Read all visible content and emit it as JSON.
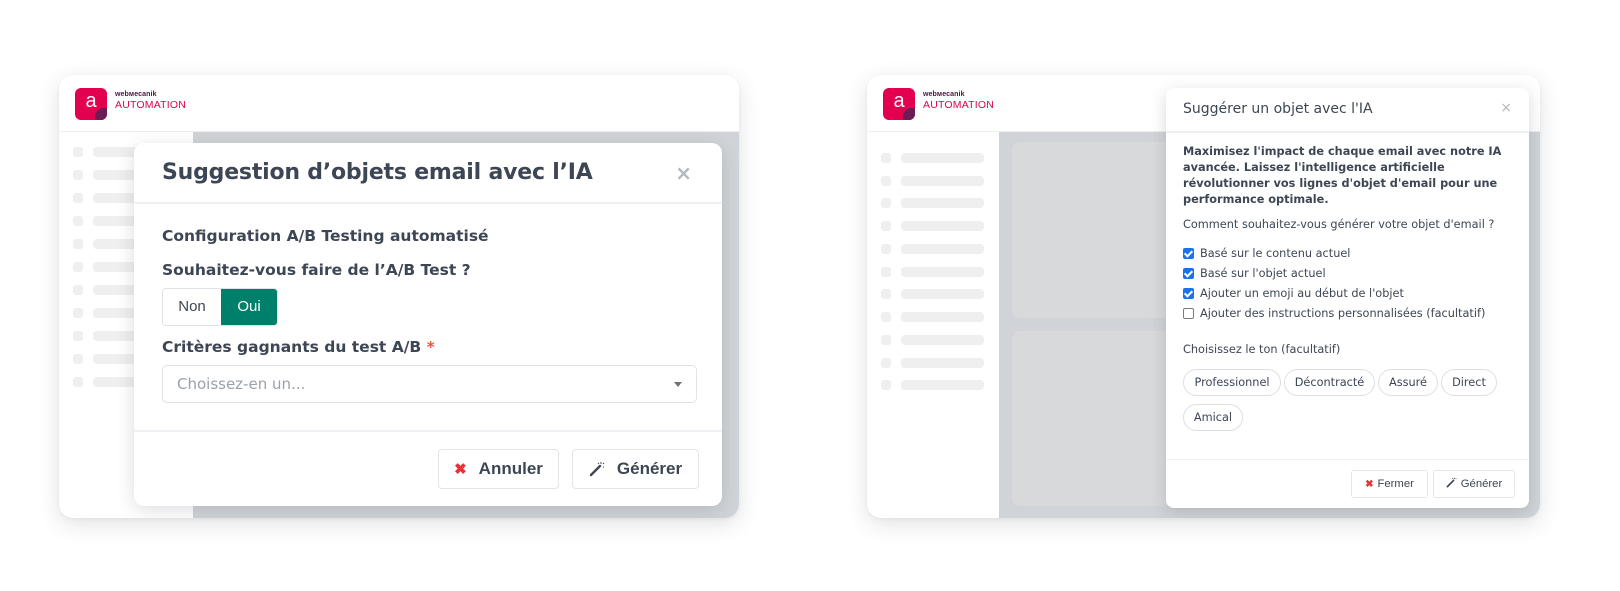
{
  "brand": {
    "small": "webмecanik",
    "big": "AUTOMATION",
    "logo_letter": "a",
    "primary_color": "#e3004f",
    "accent_color": "#6b1b55"
  },
  "left_panel": {
    "dialog": {
      "title": "Suggestion d’objets email avec l’IA",
      "close_icon": "×",
      "section_title": "Configuration A/B Testing automatisé",
      "ab_question": "Souhaitez-vous faire de l’A/B Test ?",
      "toggle": {
        "options": [
          "Non",
          "Oui"
        ],
        "selected": "Oui",
        "selected_color": "#00806a"
      },
      "criteria_label": "Critères gagnants du test A/B",
      "required_marker": "*",
      "criteria_select": {
        "placeholder": "Choissez-en un...",
        "value": ""
      },
      "buttons": {
        "cancel": "Annuler",
        "cancel_icon": "✖",
        "generate": "Générer",
        "generate_icon": "magic-wand-icon"
      }
    }
  },
  "right_panel": {
    "dialog": {
      "title": "Suggérer un objet avec l'IA",
      "close_icon": "×",
      "intro": "Maximisez l'impact de chaque email avec notre IA avancée. Laissez l'intelligence artificielle révolutionner vos lignes d'objet d'email pour une performance optimale.",
      "method_question": "Comment souhaitez-vous générer votre objet d'email ?",
      "options": [
        {
          "label": "Basé sur le contenu actuel",
          "checked": true
        },
        {
          "label": "Basé sur l'objet actuel",
          "checked": true
        },
        {
          "label": "Ajouter un emoji au début de l'objet",
          "checked": true
        },
        {
          "label": "Ajouter des instructions personnalisées (facultatif)",
          "checked": false
        }
      ],
      "tone_label": "Choisissez le ton (facultatif)",
      "tones": [
        "Professionnel",
        "Décontracté",
        "Assuré",
        "Direct",
        "Amical"
      ],
      "buttons": {
        "close": "Fermer",
        "close_icon": "✖",
        "generate": "Générer",
        "generate_icon": "magic-wand-icon"
      },
      "checkbox_color": "#1a73e8"
    }
  }
}
